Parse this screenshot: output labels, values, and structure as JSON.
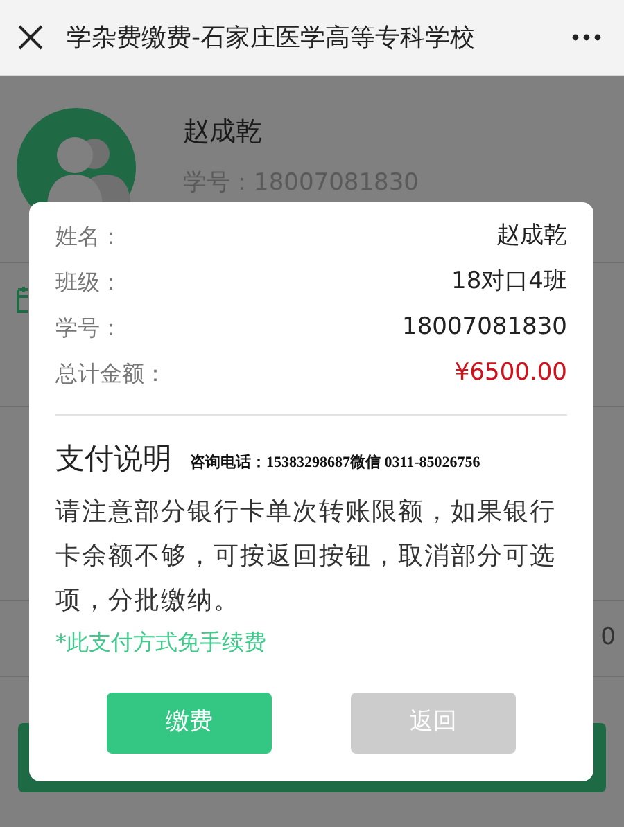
{
  "window": {
    "title": "学杂费缴费-石家庄医学高等专科学校"
  },
  "profile": {
    "name": "赵成乾",
    "student_no": "学号：18007081830"
  },
  "background": {
    "row_value": "0"
  },
  "dialog": {
    "fields": [
      {
        "label": "姓名：",
        "value": "赵成乾",
        "kind": "plain"
      },
      {
        "label": "班级：",
        "value": "18对口4班",
        "kind": "plain"
      },
      {
        "label": "学号：",
        "value": "18007081830",
        "kind": "plain"
      },
      {
        "label": "总计金额：",
        "value": "¥6500.00",
        "kind": "amount"
      }
    ],
    "section_title": "支付说明",
    "contact": "咨询电话：15383298687微信 0311-85026756",
    "notice": "请注意部分银行卡单次转账限额，如果银行卡余额不够，可按返回按钮，取消部分可选项，分批缴纳。",
    "fee_note": "*此支付方式免手续费",
    "buttons": [
      {
        "label": "缴费",
        "disabled": false
      },
      {
        "label": "返回",
        "disabled": true
      }
    ]
  }
}
